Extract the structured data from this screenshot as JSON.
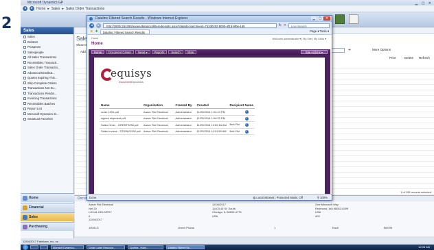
{
  "step_number": "2",
  "gp": {
    "window_title": "Microsoft Dynamics GP",
    "breadcrumb": [
      "Home",
      "Sales",
      "Sales Order Transactions"
    ],
    "sidebar_title": "Sales",
    "sidebar_items": [
      "Sales",
      "Debtors",
      "Prospects",
      "Salespeople",
      "All Sales Transactions",
      "Receivables Transacti...",
      "Sales Order Transactio...",
      "Advanced Distribut...",
      "Quotes Expiring This...",
      "Ship Complete Orders",
      "Transactions Not Su...",
      "Transactions Pendin...",
      "Invoicing Transactions",
      "Receivables Batches",
      "Report List",
      "Microsoft Dynamics G...",
      "SmartList Favorites"
    ],
    "nav_buttons": [
      "Home",
      "Financial",
      "Sales",
      "Purchasing"
    ],
    "main_title_fragment": "Sale",
    "show_fragment": "Show re",
    "add_fragment": "Add",
    "type_filter_placeholder": "Type a filter",
    "more_options": "More Options",
    "print_label": "Print",
    "delete_label": "Delete",
    "refresh_label": "Refresh",
    "records_selected": "1 of 153 records selected",
    "details_header": "Document",
    "details": {
      "bill_to_name": "Aaron Fitz Electrical",
      "payment_terms": "Net 30",
      "shipping_method": "LOCAL DELIVERY",
      "average_days_to_pay": "0",
      "requested_ship_date": "12/04/2017",
      "actual_ship_date": "12/04/2017",
      "ship_to_address": "11403 45 St. South",
      "ship_to_city": "Chicago, IL 60603-4776",
      "ship_to_country": "USA",
      "bill_to_address": "One Microsoft Way",
      "bill_to_city": "Redmond, WA 98052-6399",
      "bill_to_country": "USA",
      "vendor_number": "403",
      "item_number": "100XLG",
      "item_description": "Green Phone",
      "quantity": "1",
      "uofm": "Each",
      "price": "$59.95"
    },
    "status_left": "12/04/2017    Fabrikam, Inc.   sa"
  },
  "taskbar": {
    "items": [
      "",
      "",
      "Microsoft Dynamics...",
      "Cedar Lodge Resource...",
      "Docfiles - Hotel...",
      "Datalinc Filtered Se..."
    ],
    "clock": "12:05 AM"
  },
  "ie": {
    "title": "Datalinc Filtered Search Results - Windows Internet Explorer",
    "url": "http://2803c2qs260/pages/datadocsfilteredresults.aspx?datadocsarchiveid=7a2d0c52-8000-4f1d-9f0e-1d5",
    "search_placeholder": "Live Search",
    "tab_label": "Datalinc Filtered Search Results",
    "command_bar": "Page ▾  Tools ▾",
    "status_left": "Done",
    "zone": "Local intranet | Protected Mode: Off",
    "zoom": "100%"
  },
  "ds": {
    "breadcrumb": "Home",
    "welcome": "Welcome administrator ▾ | My Site | My Links ▾",
    "brand": "Home",
    "nav_items": [
      "Home",
      "Document Center",
      "News ▾",
      "Reports",
      "Search",
      "Sites"
    ],
    "site_actions": "Site Actions ▾",
    "logo_word": "equisys",
    "logo_sub_a": "Document",
    "logo_sub_b": "Dynamics",
    "columns": [
      "Name",
      "Organization",
      "Created By",
      "Created",
      "Recipient Name"
    ],
    "rows": [
      {
        "name": "order 1001.pdf",
        "org": "Aaron Fitz Electrical",
        "by": "Administrator",
        "created": "11/20/2016 1:04:43 PM",
        "recipient": ""
      },
      {
        "name": "signed shipment.pdf",
        "org": "Aaron Fitz Electrical",
        "by": "Administrator",
        "created": "11/20/2016 1:54:22 PM",
        "recipient": ""
      },
      {
        "name": "Sales Order - ORDST2236.pdf",
        "org": "Aaron Fitz Electrical",
        "by": "Administrator",
        "created": "11/20/2016 10:59:16 AM",
        "recipient": "Bob Fitz"
      },
      {
        "name": "Sales Invoice - STDINV2262.pdf",
        "org": "Aaron Fitz Electrical",
        "by": "Administrator",
        "created": "11/20/2016 11:01:55 AM",
        "recipient": "Bob Fitz"
      }
    ]
  },
  "colors": {
    "brand_purple": "#4a2360",
    "logo_red": "#b21e3b",
    "gp_blue": "#26528f"
  }
}
